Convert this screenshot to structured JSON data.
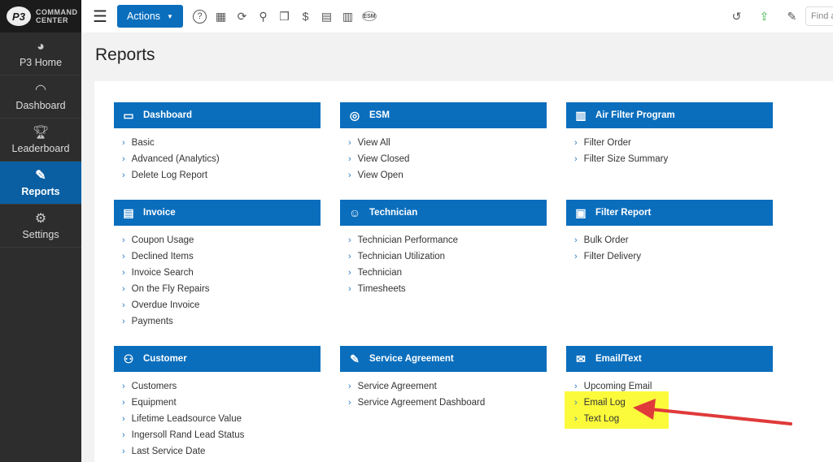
{
  "brand": {
    "logo_mark": "P3",
    "line1": "COMMAND",
    "line2": "CENTER"
  },
  "sidebar": {
    "items": [
      {
        "label": "P3 Home",
        "icon": "p3-icon"
      },
      {
        "label": "Dashboard",
        "icon": "gauge-icon"
      },
      {
        "label": "Leaderboard",
        "icon": "trophy-icon"
      },
      {
        "label": "Reports",
        "icon": "report-icon",
        "active": true
      },
      {
        "label": "Settings",
        "icon": "gear-icon"
      }
    ]
  },
  "topbar": {
    "actions_label": "Actions",
    "find_placeholder": "Find a"
  },
  "page_title": "Reports",
  "cards": [
    {
      "title": "Dashboard",
      "icon": "dashboard-icon",
      "items": [
        "Basic",
        "Advanced (Analytics)",
        "Delete Log Report"
      ]
    },
    {
      "title": "ESM",
      "icon": "esm-icon",
      "items": [
        "View All",
        "View Closed",
        "View Open"
      ]
    },
    {
      "title": "Air Filter Program",
      "icon": "air-filter-icon",
      "items": [
        "Filter Order",
        "Filter Size Summary"
      ]
    },
    {
      "title": "Invoice",
      "icon": "invoice-icon",
      "items": [
        "Coupon Usage",
        "Declined Items",
        "Invoice Search",
        "On the Fly Repairs",
        "Overdue Invoice",
        "Payments"
      ]
    },
    {
      "title": "Technician",
      "icon": "technician-icon",
      "items": [
        "Technician Performance",
        "Technician Utilization",
        "Technician",
        "Timesheets"
      ]
    },
    {
      "title": "Filter Report",
      "icon": "clipboard-icon",
      "items": [
        "Bulk Order",
        "Filter Delivery"
      ]
    },
    {
      "title": "Customer",
      "icon": "user-icon",
      "items": [
        "Customers",
        "Equipment",
        "Lifetime Leadsource Value",
        "Ingersoll Rand Lead Status",
        "Last Service Date"
      ]
    },
    {
      "title": "Service Agreement",
      "icon": "agreement-icon",
      "items": [
        "Service Agreement",
        "Service Agreement Dashboard"
      ]
    },
    {
      "title": "Email/Text",
      "icon": "envelope-icon",
      "items": [
        "Upcoming Email",
        "Email Log",
        "Text Log"
      ]
    }
  ],
  "colors": {
    "accent": "#0a6ebd",
    "highlight": "#fbfb3c",
    "arrow": "#e03a3a"
  }
}
